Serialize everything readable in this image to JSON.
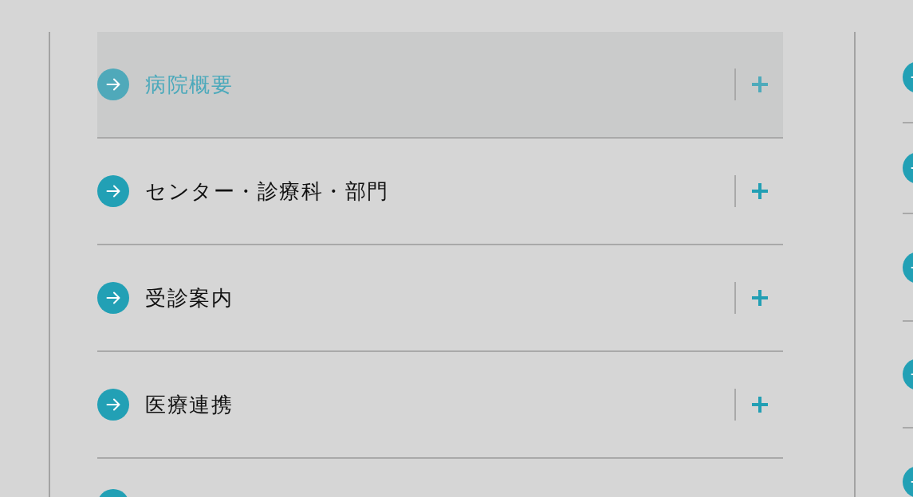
{
  "menu": {
    "items": [
      {
        "kind": "expandable",
        "label": "病院概要",
        "highlighted": true,
        "expanded": false
      },
      {
        "kind": "expandable",
        "label": "センター・診療科・部門",
        "highlighted": false,
        "expanded": false
      },
      {
        "kind": "expandable",
        "label": "受診案内",
        "highlighted": false,
        "expanded": false
      },
      {
        "kind": "expandable",
        "label": "医療連携",
        "highlighted": false,
        "expanded": false
      },
      {
        "kind": "link",
        "highlighted": false
      }
    ]
  }
}
